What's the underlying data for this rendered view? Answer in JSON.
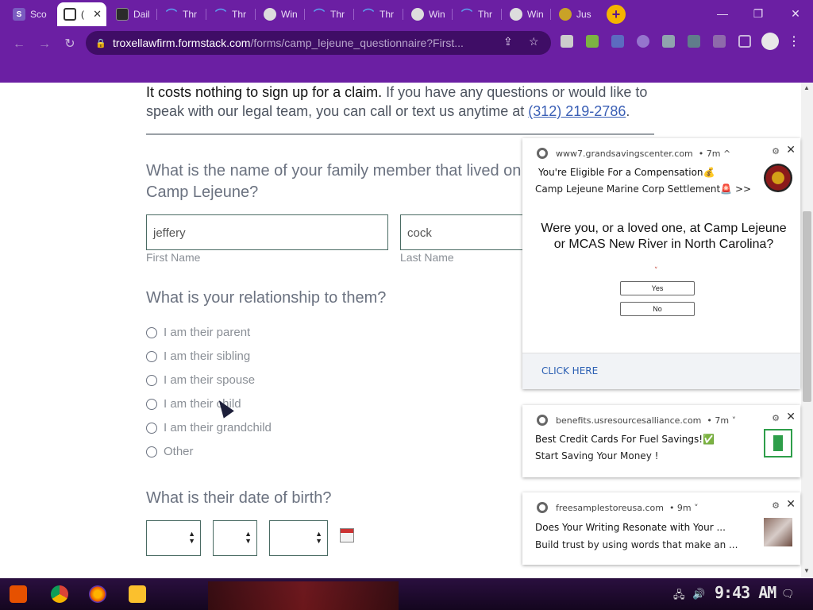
{
  "browser": {
    "tabs": [
      {
        "label": "Sco",
        "favicon": "s-icon",
        "color": "#6a4aa0"
      },
      {
        "label": "(",
        "favicon": "page-icon",
        "color": "#333333",
        "active": true
      },
      {
        "label": "Dail",
        "favicon": "cat-icon",
        "color": "#2b2b2b"
      },
      {
        "label": "Thr",
        "favicon": "rainbow-icon",
        "color": "#3b6fd8"
      },
      {
        "label": "Thr",
        "favicon": "rainbow-icon",
        "color": "#3b6fd8"
      },
      {
        "label": "Win",
        "favicon": "globe-icon",
        "color": "#888888"
      },
      {
        "label": "Thr",
        "favicon": "rainbow-icon",
        "color": "#3b6fd8"
      },
      {
        "label": "Thr",
        "favicon": "rainbow-icon",
        "color": "#3b6fd8"
      },
      {
        "label": "Win",
        "favicon": "globe-icon",
        "color": "#888888"
      },
      {
        "label": "Thr",
        "favicon": "rainbow-icon",
        "color": "#3b6fd8"
      },
      {
        "label": "Win",
        "favicon": "globe-icon",
        "color": "#888888"
      },
      {
        "label": "Jus",
        "favicon": "globe-icon",
        "color": "#c9a227"
      }
    ],
    "url_domain": "troxellawfirm.formstack.com",
    "url_path": "/forms/camp_lejeune_questionnaire?First..."
  },
  "form": {
    "intro_bold": "It costs nothing to sign up for a claim.",
    "intro_rest": " If you have any questions or would like to speak with our legal team, you can call or text us anytime at ",
    "phone": "(312) 219-2786",
    "intro_end": ".",
    "q_name": "What is the name of your family member that lived on Camp Lejeune?",
    "first_name_value": "jeffery",
    "last_name_value": "cock",
    "first_name_label": "First Name",
    "last_name_label": "Last Name",
    "q_relationship": "What is your relationship to them?",
    "relationship_options": [
      "I am their parent",
      "I am their sibling",
      "I am their spouse",
      "I am their child",
      "I am their grandchild",
      "Other"
    ],
    "q_dob": "What is their date of birth?"
  },
  "notifications": [
    {
      "source": "www7.grandsavingscenter.com",
      "meta": "• 7m ^",
      "title": "You're Eligible For a Compensation💰",
      "body": "Camp Lejeune Marine Corp Settlement🚨 >>",
      "question": "Were you, or a loved one, at Camp Lejeune or MCAS New River in North Carolina?",
      "yes": "Yes",
      "no": "No",
      "cta": "CLICK HERE"
    },
    {
      "source": "benefits.usresourcesalliance.com",
      "meta": "• 7m ˅",
      "title": "Best Credit Cards For Fuel Savings!✅",
      "body": "Start Saving Your Money !"
    },
    {
      "source": "freesamplestoreusa.com",
      "meta": "• 9m ˅",
      "title": "Does Your Writing Resonate with Your ...",
      "body": "Build trust by using words that make an ..."
    }
  ],
  "taskbar": {
    "clock": "9:43 AM"
  }
}
